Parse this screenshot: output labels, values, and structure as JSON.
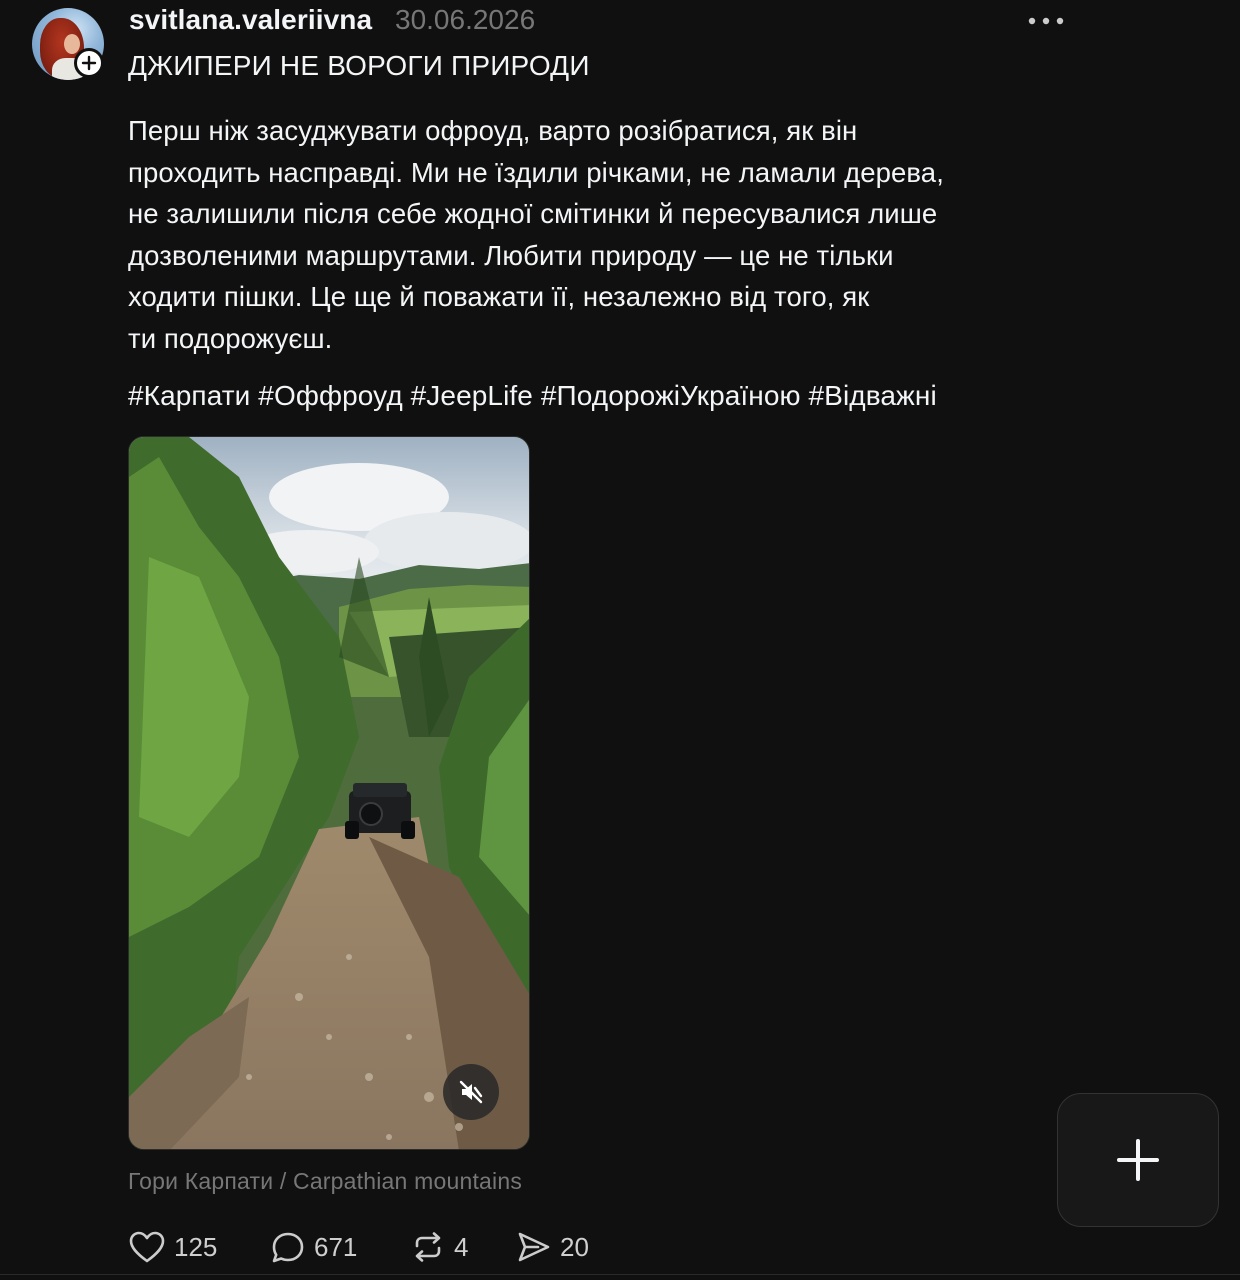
{
  "post": {
    "username": "svitlana.valeriivna",
    "date": "30.06.2026",
    "headline": "ДЖИПЕРИ НЕ ВОРОГИ ПРИРОДИ",
    "body": "Перш ніж засуджувати офроуд, варто розібратися, як він\nпроходить насправді. Ми не їздили річками, не ламали дерева,\nне залишили після себе жодної смітинки й пересувалися лише\nдозволеними маршрутами. Любити природу — це не тільки\nходити пішки. Це ще й поважати її, незалежно від того, як\nти подорожуєш.",
    "hashtags": "#Карпати #Оффроуд #JeepLife #ПодорожіУкраїною #Відважні",
    "media_caption": "Гори Карпати / Carpathian mountains",
    "media_muted": true
  },
  "actions": {
    "likes": "125",
    "comments": "671",
    "reposts": "4",
    "shares": "20"
  },
  "icons": {
    "like": "heart-icon",
    "comment": "comment-bubble-icon",
    "repost": "repost-icon",
    "share": "send-icon",
    "more": "ellipsis-icon",
    "follow": "plus-icon",
    "mute": "speaker-muted-icon",
    "compose": "plus-icon"
  }
}
